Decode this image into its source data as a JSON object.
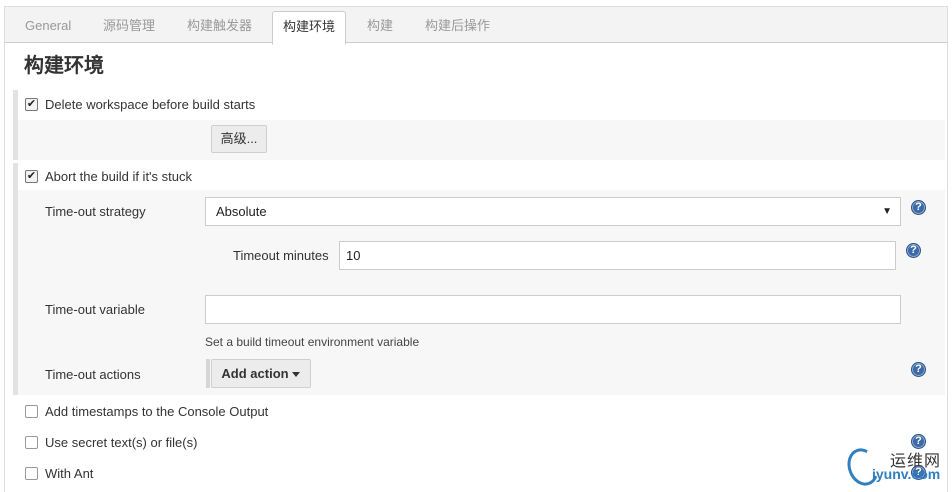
{
  "tabs": [
    {
      "label": "General"
    },
    {
      "label": "源码管理"
    },
    {
      "label": "构建触发器"
    },
    {
      "label": "构建环境"
    },
    {
      "label": "构建"
    },
    {
      "label": "构建后操作"
    }
  ],
  "active_tab": "构建环境",
  "section": {
    "title": "构建环境"
  },
  "options": {
    "delete_workspace": {
      "label": "Delete workspace before build starts",
      "checked": true
    },
    "advanced_button": "高级...",
    "abort_stuck": {
      "label": "Abort the build if it's stuck",
      "checked": true
    },
    "timeout_strategy": {
      "label": "Time-out strategy",
      "value": "Absolute"
    },
    "timeout_minutes": {
      "label": "Timeout minutes",
      "value": "10"
    },
    "timeout_variable": {
      "label": "Time-out variable",
      "value": "",
      "hint": "Set a build timeout environment variable"
    },
    "timeout_actions": {
      "label": "Time-out actions",
      "button": "Add action"
    },
    "add_timestamps": {
      "label": "Add timestamps to the Console Output",
      "checked": false
    },
    "secret_text": {
      "label": "Use secret text(s) or file(s)",
      "checked": false
    },
    "with_ant": {
      "label": "With Ant",
      "checked": false
    }
  },
  "help_glyph": "?",
  "watermark": {
    "cn": "运维网",
    "en": "iyunv.com"
  },
  "colors": {
    "help_icon": "#3c6aa8",
    "tab_bar_bg": "#f3f3f3",
    "block_bg": "#f7f7f7",
    "watermark_blue": "#2f7fc1"
  }
}
